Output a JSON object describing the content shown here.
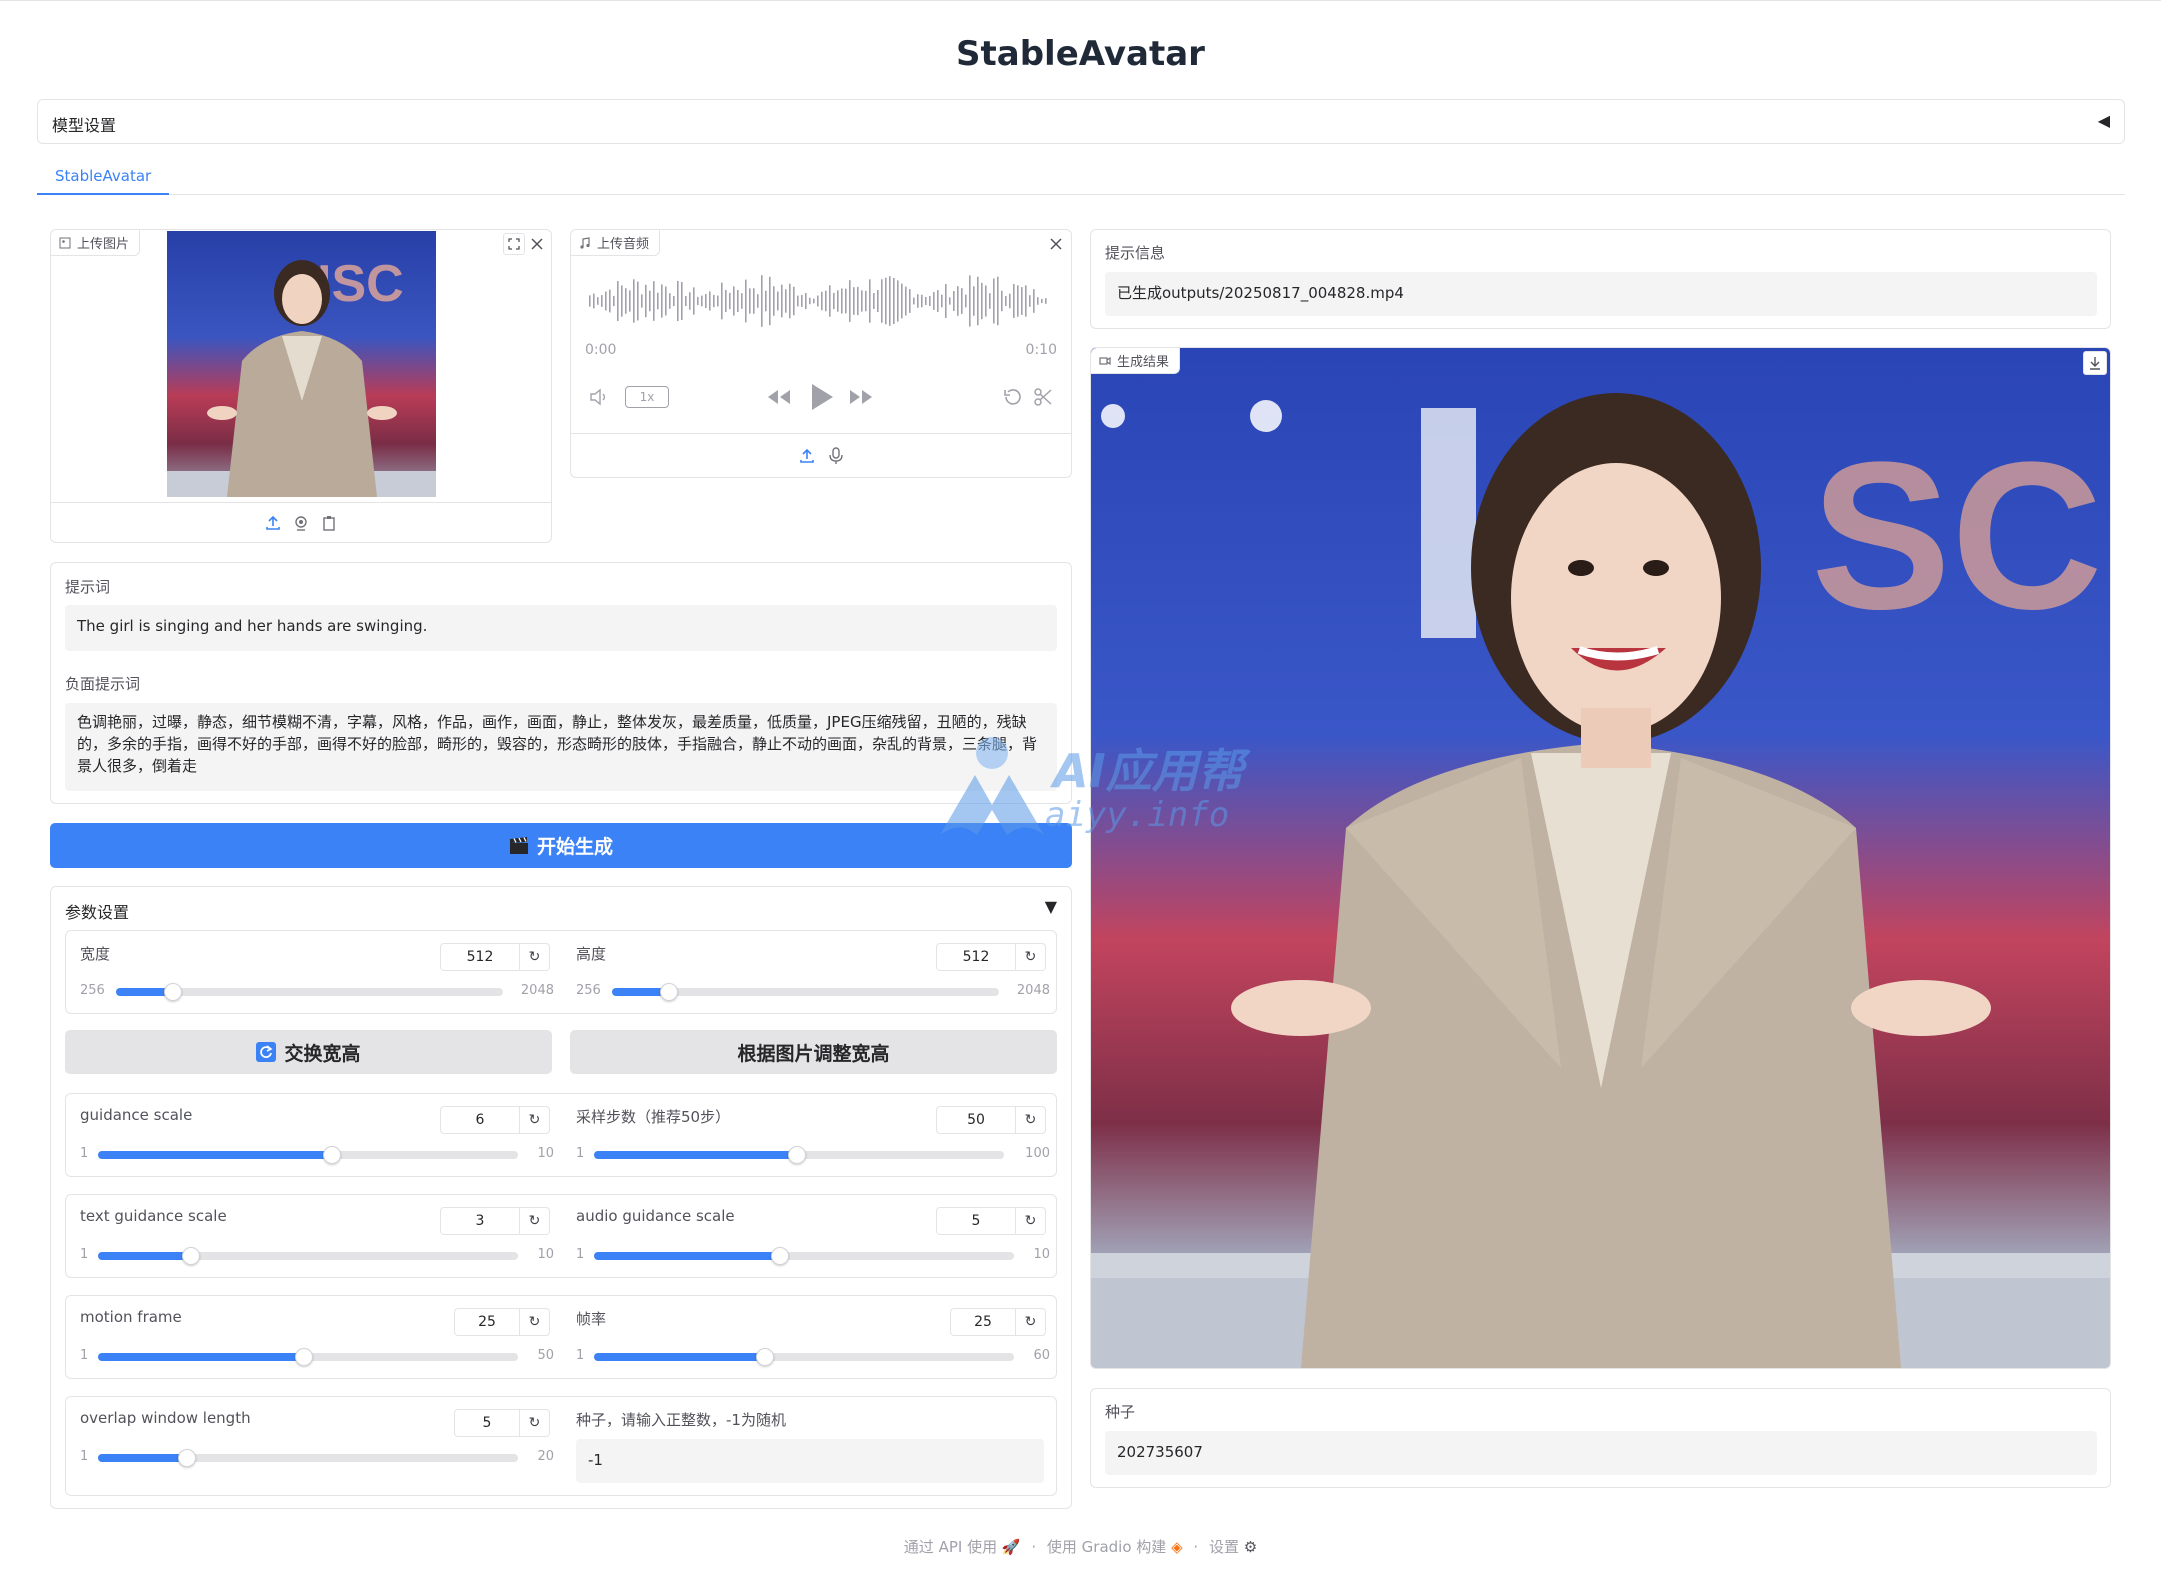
{
  "app": {
    "title": "StableAvatar"
  },
  "model_settings": {
    "label": "模型设置",
    "toggle": "◀"
  },
  "tabs": [
    {
      "label": "StableAvatar"
    }
  ],
  "image_input": {
    "label": "上传图片"
  },
  "audio_input": {
    "label": "上传音频",
    "time_start": "0:00",
    "time_end": "0:10",
    "speed": "1x"
  },
  "prompt": {
    "label": "提示词",
    "value": "The girl is singing and her hands are swinging."
  },
  "negative_prompt": {
    "label": "负面提示词",
    "value": "色调艳丽，过曝，静态，细节模糊不清，字幕，风格，作品，画作，画面，静止，整体发灰，最差质量，低质量，JPEG压缩残留，丑陋的，残缺的，多余的手指，画得不好的手部，画得不好的脸部，畸形的，毁容的，形态畸形的肢体，手指融合，静止不动的画面，杂乱的背景，三条腿，背景人很多，倒着走"
  },
  "generate_button": {
    "label": "开始生成",
    "icon": "clapper-board",
    "color": "#3b82f6"
  },
  "params": {
    "label": "参数设置",
    "toggle": "▼",
    "width": {
      "label": "宽度",
      "value": "512",
      "min": "256",
      "max": "2048",
      "fraction": 0.146
    },
    "height": {
      "label": "高度",
      "value": "512",
      "min": "256",
      "max": "2048",
      "fraction": 0.146
    },
    "swap_button": {
      "label": "交换宽高",
      "icon": "refresh-icon"
    },
    "fit_button": {
      "label": "根据图片调整宽高"
    },
    "guidance_scale": {
      "label": "guidance scale",
      "value": "6",
      "min": "1",
      "max": "10",
      "fraction": 0.556
    },
    "steps": {
      "label": "采样步数（推荐50步）",
      "value": "50",
      "min": "1",
      "max": "100",
      "fraction": 0.495
    },
    "text_guidance": {
      "label": "text guidance scale",
      "value": "3",
      "min": "1",
      "max": "10",
      "fraction": 0.222
    },
    "audio_guidance": {
      "label": "audio guidance scale",
      "value": "5",
      "min": "1",
      "max": "10",
      "fraction": 0.444
    },
    "motion_frame": {
      "label": "motion frame",
      "value": "25",
      "min": "1",
      "max": "50",
      "fraction": 0.49
    },
    "fps": {
      "label": "帧率",
      "value": "25",
      "min": "1",
      "max": "60",
      "fraction": 0.407
    },
    "overlap": {
      "label": "overlap window length",
      "value": "5",
      "min": "1",
      "max": "20",
      "fraction": 0.211
    },
    "seed": {
      "label": "种子，请输入正整数，-1为随机",
      "value": "-1"
    }
  },
  "info": {
    "label": "提示信息",
    "value": "已生成outputs/20250817_004828.mp4"
  },
  "video_output": {
    "label": "生成结果"
  },
  "seed_output": {
    "label": "种子",
    "value": "202735607"
  },
  "watermark": {
    "line1": "AI应用帮",
    "line2": "aiyy.info"
  },
  "footer": {
    "api": "通过 API 使用",
    "built": "使用 Gradio 构建",
    "settings": "设置",
    "sep": "·"
  }
}
